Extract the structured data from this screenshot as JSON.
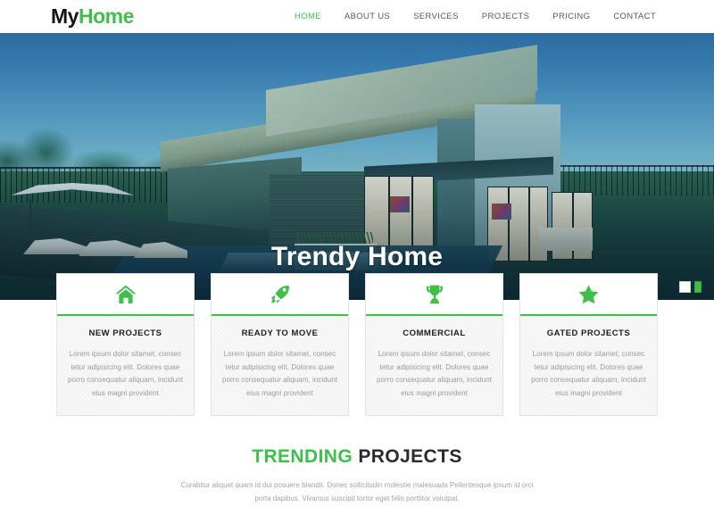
{
  "header": {
    "logo": {
      "first": "My",
      "second": "Home",
      "color_first": "#141414",
      "color_second": "#3ebf4a"
    },
    "nav": [
      {
        "label": "HOME",
        "active": true
      },
      {
        "label": "ABOUT US",
        "active": false
      },
      {
        "label": "SERVICES",
        "active": false
      },
      {
        "label": "PROJECTS",
        "active": false
      },
      {
        "label": "PRICING",
        "active": false
      },
      {
        "label": "CONTACT",
        "active": false
      }
    ]
  },
  "hero": {
    "title": "Trendy Home",
    "image_description": "Modern flat-roof house at dusk with swimming pool, sun loungers and patio umbrella",
    "slider": {
      "dot_color": "#ffffff",
      "next_color": "#3ebf4a"
    }
  },
  "features": [
    {
      "icon": "home-icon",
      "title": "NEW PROJECTS",
      "text": "Lorem ipsum dolor sitamet, consec tetur adipisicing elit. Dolores quae porro consequatur aliquam, incidunt eius magni provident"
    },
    {
      "icon": "rocket-icon",
      "title": "READY TO MOVE",
      "text": "Lorem ipsum dolor sitamet, consec tetur adipisicing elit. Dolores quae porro consequatur aliquam, incidunt eius magni provident"
    },
    {
      "icon": "trophy-icon",
      "title": "COMMERCIAL",
      "text": "Lorem ipsum dolor sitamet, consec tetur adipisicing elit. Dolores quae porro consequatur aliquam, incidunt eius magni provident"
    },
    {
      "icon": "star-icon",
      "title": "GATED PROJECTS",
      "text": "Lorem ipsum dolor sitamet, consec tetur adipisicing elit. Dolores quae porro consequatur aliquam, incidunt eius magni provident"
    }
  ],
  "trending": {
    "heading_green": "TRENDING",
    "heading_dark": "PROJECTS",
    "description": "Curabitur aliquet quam id dui posuere blandit. Donec sollicitudin molestie malesuada Pellentesque ipsum id orci porta dapibus. Vivamus suscipit tortor eget felis porttitor volutpat."
  },
  "theme": {
    "accent_green": "#3ebf4a",
    "text_dark": "#1d1d1d",
    "text_muted": "#9a9a9a",
    "card_bg": "#f8f8f8",
    "page_bg": "#ffffff"
  }
}
